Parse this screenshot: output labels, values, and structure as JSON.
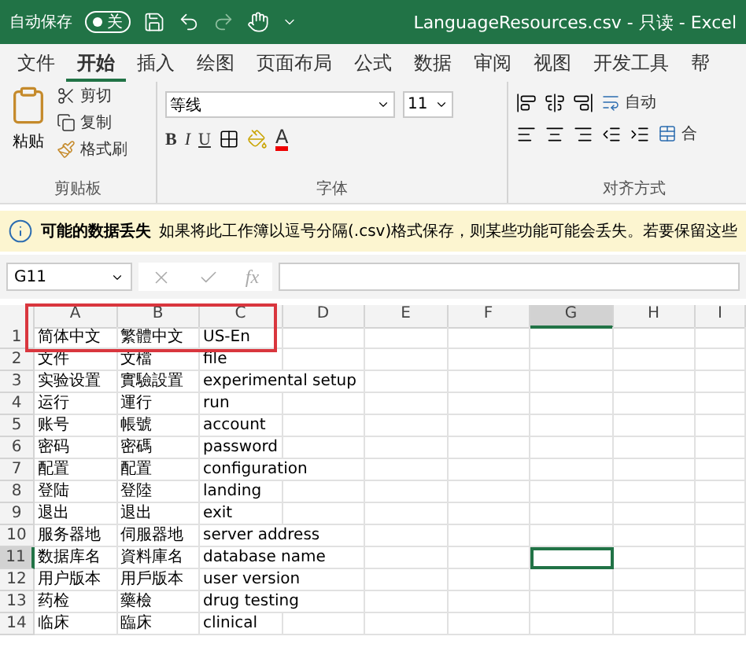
{
  "title_bar": {
    "autosave_label": "自动保存",
    "autosave_on": false,
    "autosave_state": "关",
    "title": "LanguageResources.csv - 只读 - Excel"
  },
  "tabs": [
    {
      "label": "文件",
      "selected": false
    },
    {
      "label": "开始",
      "selected": true
    },
    {
      "label": "插入",
      "selected": false
    },
    {
      "label": "绘图",
      "selected": false
    },
    {
      "label": "页面布局",
      "selected": false
    },
    {
      "label": "公式",
      "selected": false
    },
    {
      "label": "数据",
      "selected": false
    },
    {
      "label": "审阅",
      "selected": false
    },
    {
      "label": "视图",
      "selected": false
    },
    {
      "label": "开发工具",
      "selected": false
    },
    {
      "label": "帮",
      "selected": false
    }
  ],
  "ribbon": {
    "clipboard": {
      "paste": "粘贴",
      "cut": "剪切",
      "copy": "复制",
      "format_painter": "格式刷",
      "label": "剪贴板"
    },
    "font": {
      "name": "等线",
      "size": "11",
      "style_buttons": [
        "B",
        "I",
        "U"
      ],
      "font_color_letter": "A",
      "label": "字体"
    },
    "alignment": {
      "wrap": "自动",
      "merge": "合",
      "label": "对齐方式"
    }
  },
  "info_bar": {
    "title": "可能的数据丢失",
    "message": "如果将此工作簿以逗号分隔(.csv)格式保存，则某些功能可能会丢失。若要保留这些"
  },
  "formula_bar": {
    "name_box": "G11",
    "function_label": "fx"
  },
  "sheet": {
    "highlight_box": true,
    "columns": [
      {
        "label": "A",
        "selected": false
      },
      {
        "label": "B",
        "selected": false
      },
      {
        "label": "C",
        "selected": false
      },
      {
        "label": "D",
        "selected": false
      },
      {
        "label": "E",
        "selected": false
      },
      {
        "label": "F",
        "selected": false
      },
      {
        "label": "G",
        "selected": true
      },
      {
        "label": "H",
        "selected": false
      },
      {
        "label": "I",
        "selected": false
      }
    ],
    "rows": [
      {
        "number": "1",
        "selected": false,
        "cells": [
          "简体中文",
          "繁體中文",
          "US-En"
        ]
      },
      {
        "number": "2",
        "selected": false,
        "cells": [
          "文件",
          "文檔",
          "file"
        ]
      },
      {
        "number": "3",
        "selected": false,
        "cells": [
          "实验设置",
          "實驗設置",
          "experimental setup"
        ]
      },
      {
        "number": "4",
        "selected": false,
        "cells": [
          "运行",
          "運行",
          "run"
        ]
      },
      {
        "number": "5",
        "selected": false,
        "cells": [
          "账号",
          "帳號",
          "account"
        ]
      },
      {
        "number": "6",
        "selected": false,
        "cells": [
          "密码",
          "密碼",
          "password"
        ]
      },
      {
        "number": "7",
        "selected": false,
        "cells": [
          "配置",
          "配置",
          "configuration"
        ]
      },
      {
        "number": "8",
        "selected": false,
        "cells": [
          "登陆",
          "登陸",
          "landing"
        ]
      },
      {
        "number": "9",
        "selected": false,
        "cells": [
          "退出",
          "退出",
          "exit"
        ]
      },
      {
        "number": "10",
        "selected": false,
        "cells": [
          "服务器地",
          "伺服器地",
          "server address"
        ]
      },
      {
        "number": "11",
        "selected": true,
        "cells": [
          "数据库名",
          "資料庫名",
          "database name"
        ]
      },
      {
        "number": "12",
        "selected": false,
        "cells": [
          "用户版本",
          "用戶版本",
          "user version"
        ]
      },
      {
        "number": "13",
        "selected": false,
        "cells": [
          "药检",
          "藥檢",
          "drug testing"
        ]
      },
      {
        "number": "14",
        "selected": false,
        "cells": [
          "临床",
          "臨床",
          "clinical"
        ]
      }
    ]
  }
}
